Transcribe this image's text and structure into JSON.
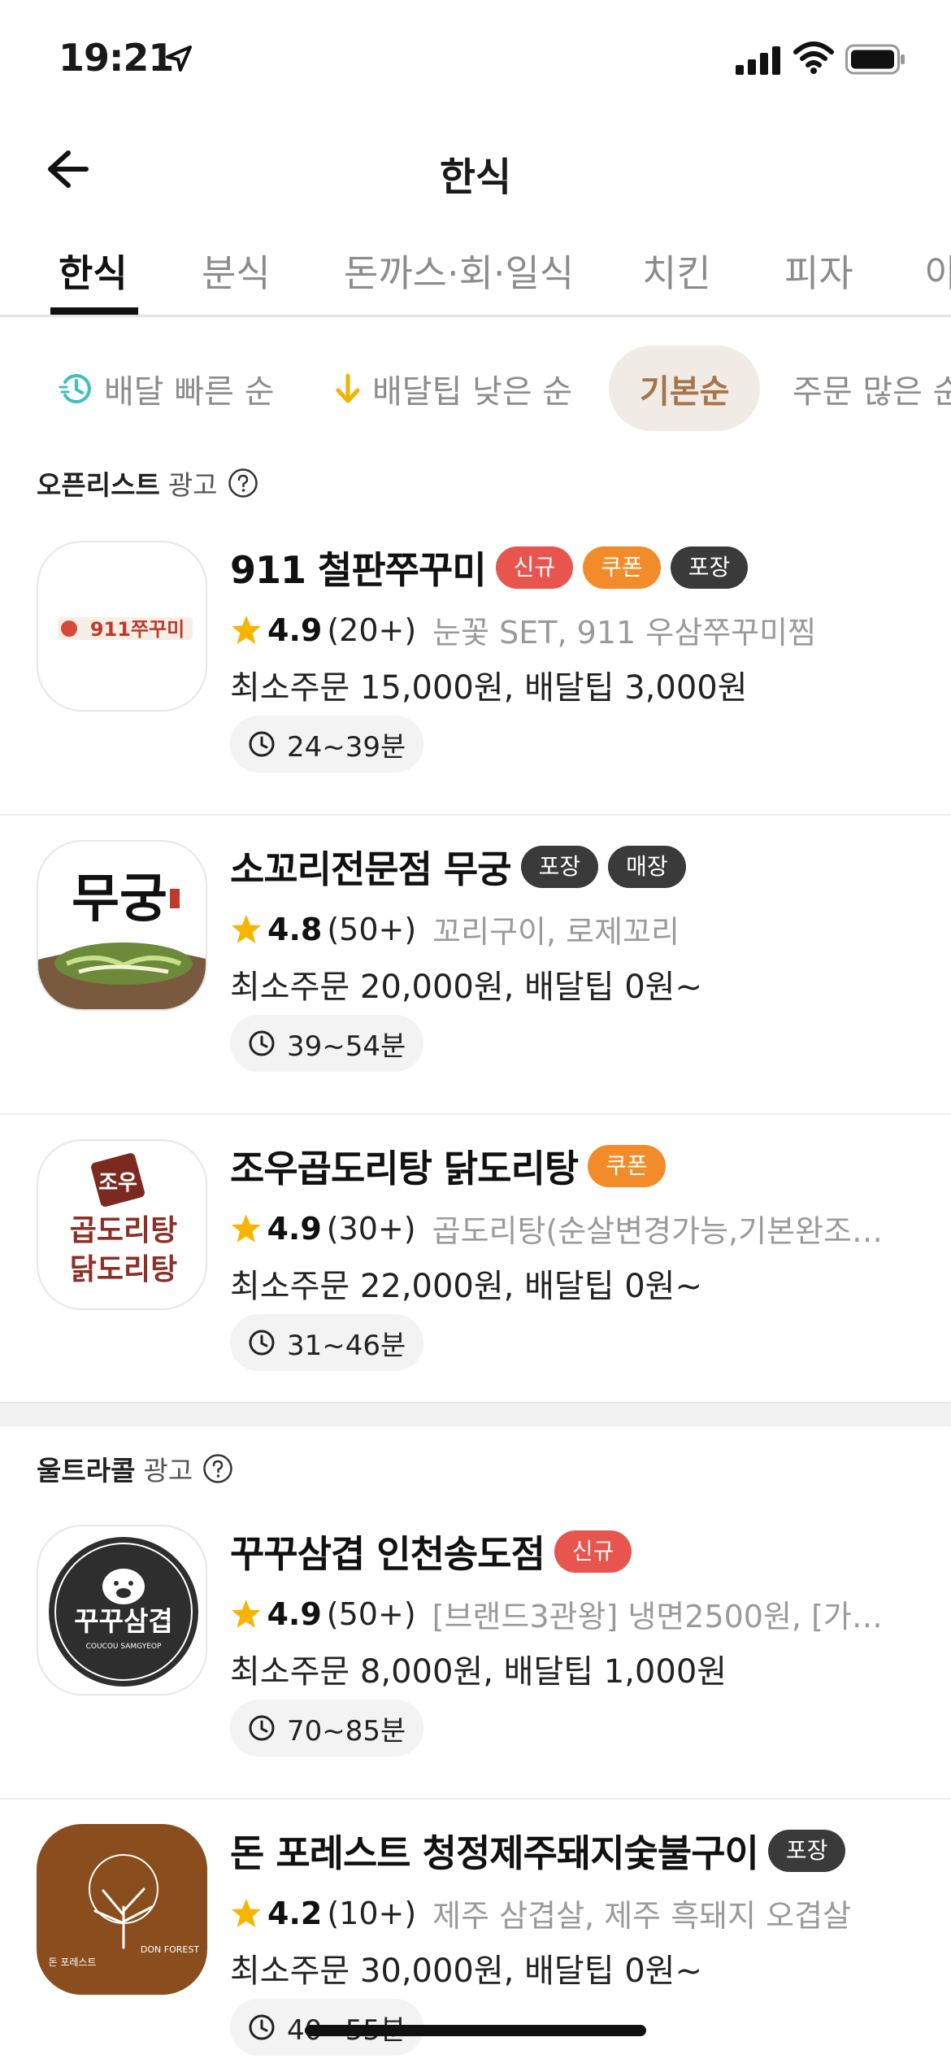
{
  "status_bar": {
    "time": "19:21"
  },
  "header": {
    "title": "한식"
  },
  "tabs": [
    {
      "label": "한식",
      "active": true
    },
    {
      "label": "분식",
      "active": false
    },
    {
      "label": "돈까스·회·일식",
      "active": false
    },
    {
      "label": "치킨",
      "active": false
    },
    {
      "label": "피자",
      "active": false
    },
    {
      "label": "아",
      "active": false
    }
  ],
  "sorts": [
    {
      "label": "배달 빠른 순",
      "icon": "fast-delivery-icon",
      "active": false
    },
    {
      "label": "배달팁 낮은 순",
      "icon": "arrow-down-icon",
      "active": false
    },
    {
      "label": "기본순",
      "active": true
    },
    {
      "label": "주문 많은 순",
      "active": false
    }
  ],
  "sections": [
    {
      "name": "오픈리스트",
      "ad": "광고"
    },
    {
      "name": "울트라콜",
      "ad": "광고"
    }
  ],
  "colors": {
    "badge_new": "#e8544e",
    "badge_coupon": "#f28c2a",
    "badge_dark": "#3a3a3a",
    "star": "#f7b500",
    "accent_brown": "#a8754a"
  },
  "restaurants": [
    {
      "name": "911 철판쭈꾸미",
      "badges": [
        "신규",
        "쿠폰",
        "포장"
      ],
      "rating": "4.9",
      "reviews": "(20+)",
      "menu": "눈꽃 SET, 911 우삼쭈꾸미찜",
      "min_order": "최소주문 15,000원, 배달팁 3,000원",
      "time": "24~39분",
      "logo_text": "911쭈꾸미"
    },
    {
      "name": "소꼬리전문점 무궁",
      "badges": [
        "포장",
        "매장"
      ],
      "rating": "4.8",
      "reviews": "(50+)",
      "menu": "꼬리구이, 로제꼬리",
      "min_order": "최소주문 20,000원, 배달팁 0원~",
      "time": "39~54분",
      "logo_text": "무궁"
    },
    {
      "name": "조우곱도리탕 닭도리탕",
      "badges": [
        "쿠폰"
      ],
      "rating": "4.9",
      "reviews": "(30+)",
      "menu": "곱도리탕(순살변경가능,기본완조리…",
      "min_order": "최소주문 22,000원, 배달팁 0원~",
      "time": "31~46분",
      "logo_text": [
        "조우",
        "곱도리탕",
        "닭도리탕"
      ]
    },
    {
      "name": "꾸꾸삼겹 인천송도점",
      "badges": [
        "신규"
      ],
      "rating": "4.9",
      "reviews": "(50+)",
      "menu": "[브랜드3관왕] 냉면2500원, [가성…",
      "min_order": "최소주문 8,000원, 배달팁 1,000원",
      "time": "70~85분",
      "logo_text": [
        "꾸꾸삼겹",
        "COUCOU SAMGYEOP"
      ]
    },
    {
      "name": "돈 포레스트 청정제주돼지숯불구이",
      "badges": [
        "포장"
      ],
      "rating": "4.2",
      "reviews": "(10+)",
      "menu": "제주 삼겹살, 제주 흑돼지 오겹살",
      "min_order": "최소주문 30,000원, 배달팁 0원~",
      "time": "40~55분",
      "logo_text": [
        "돈 포레스트",
        "DON FOREST"
      ]
    }
  ]
}
